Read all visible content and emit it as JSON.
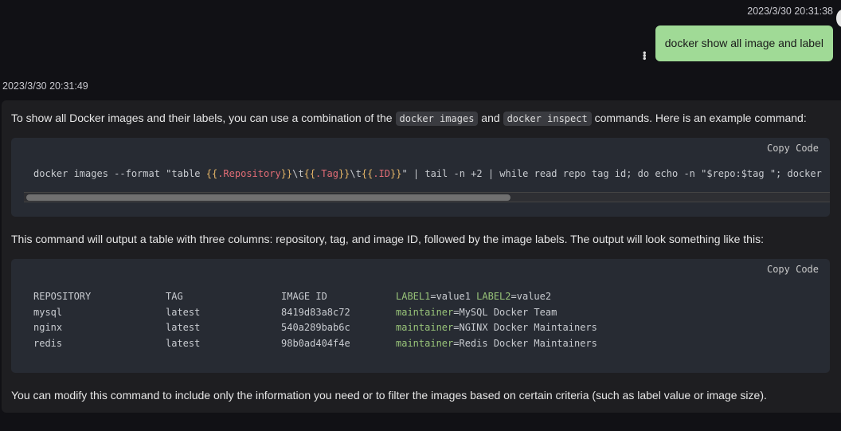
{
  "user_message": {
    "timestamp": "2023/3/30 20:31:38",
    "text": "docker show all image and label"
  },
  "assistant": {
    "timestamp": "2023/3/30 20:31:49",
    "intro": {
      "before": "To show all Docker images and their labels, you can use a combination of the ",
      "code1": "docker images",
      "mid": " and ",
      "code2": "docker inspect",
      "after": " commands. Here is an example command:"
    },
    "code_block_1": {
      "copy_label": "Copy Code",
      "parts": [
        "docker images --format \"table ",
        "{{",
        ".Repository",
        "}}",
        "\\t",
        "{{",
        ".Tag",
        "}}",
        "\\t",
        "{{",
        ".ID",
        "}}",
        "\" | tail -n +2 | while read repo tag id; do echo -n \"$repo:$tag \"; docker"
      ],
      "scroll_fraction": 0.59
    },
    "middle": "This command will output a table with three columns: repository, tag, and image ID, followed by the image labels. The output will look something like this:",
    "code_block_2": {
      "copy_label": "Copy Code",
      "header": [
        "REPOSITORY",
        "TAG",
        "IMAGE ID"
      ],
      "header_labels": {
        "k1": "LABEL1",
        "v1": "=value1 ",
        "k2": "LABEL2",
        "v2": "=value2"
      },
      "rows": [
        {
          "repo": "mysql",
          "tag": "latest",
          "id": "8419d83a8c72",
          "key": "maintainer",
          "value": "=MySQL Docker Team"
        },
        {
          "repo": "nginx",
          "tag": "latest",
          "id": "540a289bab6c",
          "key": "maintainer",
          "value": "=NGINX Docker Maintainers"
        },
        {
          "repo": "redis",
          "tag": "latest",
          "id": "98b0ad404f4e",
          "key": "maintainer",
          "value": "=Redis Docker Maintainers"
        }
      ]
    },
    "outro": "You can modify this command to include only the information you need or to filter the images based on certain criteria (such as label value or image size)."
  },
  "colors": {
    "user_bubble": "#a0da96",
    "background": "#111115",
    "code_bg": "#272b33"
  }
}
